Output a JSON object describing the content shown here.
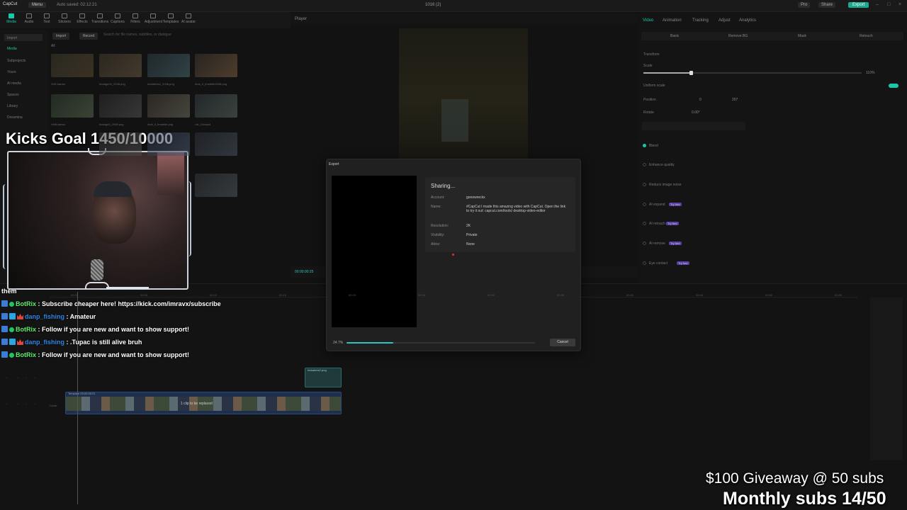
{
  "app": {
    "logo": "CapCut",
    "menu_label": "Menu",
    "autosave": "Auto saved: 02:12:21",
    "project_title": "1016 (2)",
    "pro_label": "Pro",
    "share_label": "Share",
    "export_label": "Export"
  },
  "toolbar": {
    "items": [
      "Media",
      "Audio",
      "Text",
      "Stickers",
      "Effects",
      "Transitions",
      "Captions",
      "Filters",
      "Adjustment",
      "Templates",
      "AI avatar"
    ]
  },
  "media_nav": {
    "items": [
      "Import",
      "Media",
      "Subprojects",
      "Yours",
      "AI media",
      "Spaces",
      "Library",
      "Dreamina"
    ]
  },
  "media": {
    "import_label": "Import",
    "record_label": "Record",
    "search_placeholder": "Search for file names, subtitles, or dialogue",
    "filter_all": "All",
    "thumb_labels": [
      "Vid1.kansa",
      "footage02_2048.png",
      "kickalerts2_2048.png",
      "dust_4_frostbite2048.png",
      "Vid6.kansa",
      "footage3_2048.png",
      "dust_2_frostbite.png",
      "vid_2.kickpd",
      "",
      "",
      "",
      ""
    ]
  },
  "player": {
    "title": "Player",
    "timecode": "00:00:00:25"
  },
  "right_panel": {
    "tabs": [
      "Video",
      "Animation",
      "Tracking",
      "Adjust",
      "Analytics"
    ],
    "subtabs": [
      "Basic",
      "Remove BG",
      "Mask",
      "Retouch"
    ],
    "transform": "Transform",
    "scale_label": "Scale",
    "scale_value": "110%",
    "uniform_scale": "Uniform scale",
    "position_label": "Position",
    "pos_x": "0",
    "pos_y": "207",
    "rotate_label": "Rotate",
    "rotate_value": "0.00°",
    "blend": "Blend",
    "enhance_quality": "Enhance quality",
    "reduce_noise": "Reduce image noise",
    "ai_expand": "AI expand",
    "ai_retouch": "AI retouch",
    "ai_remove": "AI remove",
    "eye_contact": "Eye contact",
    "badge_try": "Try free"
  },
  "timeline": {
    "clip_label": "Template 00:00:59:21",
    "clip_replace": "1 clip to be replaced",
    "image_clip": "kickalerts2.png",
    "cover_label": "Cover",
    "ruler_marks": [
      "00:00",
      "00:05",
      "00:10",
      "00:15",
      "00:20",
      "00:25",
      "00:30",
      "00:35",
      "00:40",
      "00:45",
      "00:50",
      "00:55"
    ]
  },
  "export_dialog": {
    "title": "Export",
    "status": "Sharing...",
    "fields": [
      {
        "key": "Account:",
        "value": "gonewreckx"
      },
      {
        "key": "Name:",
        "value": "#CapCut I made this amazing video with CapCut. Open the link to try it out: capcut.com/tools/ desktop-video-editor"
      },
      {
        "key": "Resolution:",
        "value": "2K"
      },
      {
        "key": "Visibility:",
        "value": "Private"
      },
      {
        "key": "Allow:",
        "value": "None"
      }
    ],
    "progress_label": "24.7%",
    "progress": 0.247,
    "cancel_label": "Cancel"
  },
  "overlay": {
    "kicks_goal": "Kicks Goal 1450/10000",
    "chat_top": "them",
    "chat": [
      {
        "user": "BotRix",
        "kind": "bot",
        "text": ": Subscribe cheaper here! https://kick.com/imravx/subscribe"
      },
      {
        "user": "danp_fishing",
        "kind": "sub",
        "text": ": Amateur"
      },
      {
        "user": "BotRix",
        "kind": "bot",
        "text": ": Follow if you are new and want to show support!"
      },
      {
        "user": "danp_fishing",
        "kind": "sub",
        "text": ": .Tupac is still alive bruh"
      },
      {
        "user": "BotRix",
        "kind": "bot",
        "text": ": Follow if you are new and want to show support!"
      }
    ],
    "giveaway": "$100 Giveaway @ 50 subs",
    "monthly": "Monthly subs 14/50"
  },
  "colors": {
    "accent": "#1cc7a7",
    "progress": "#2fc6c1",
    "botrix": "#5ef06a",
    "danp": "#2d86e8"
  }
}
